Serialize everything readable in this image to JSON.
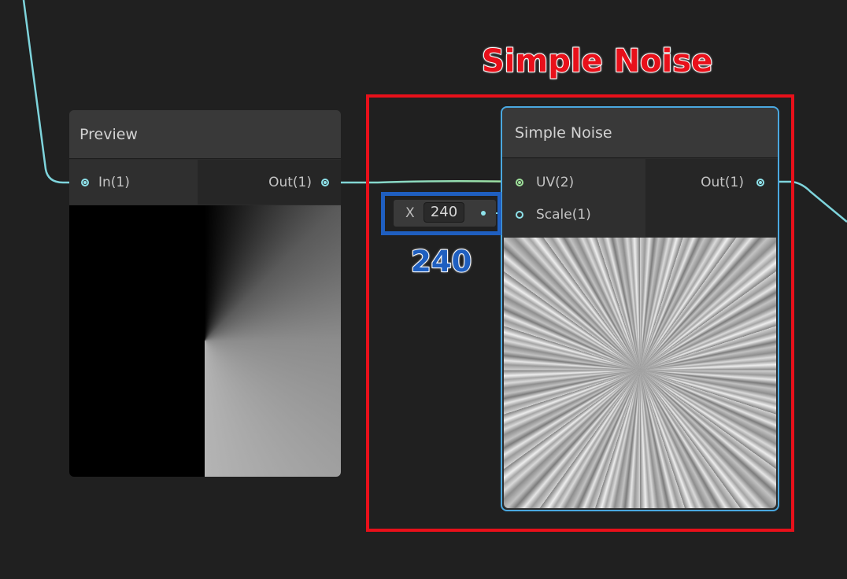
{
  "annotation": {
    "title": "Simple Noise",
    "value_label": "240",
    "title_color": "#e8101a",
    "highlight_color": "#1f5fc0"
  },
  "preview_node": {
    "title": "Preview",
    "input_port": "In(1)",
    "output_port": "Out(1)"
  },
  "simple_noise_node": {
    "title": "Simple Noise",
    "inputs": [
      "UV(2)",
      "Scale(1)"
    ],
    "output_port": "Out(1)"
  },
  "scale_field": {
    "axis_label": "X",
    "value": "240"
  },
  "colors": {
    "background": "#202020",
    "wire": "#7ed4dc",
    "uv_wire": "#9ee09a",
    "selection": "#4aa8e0"
  }
}
